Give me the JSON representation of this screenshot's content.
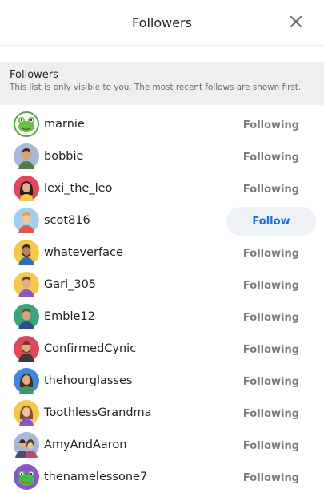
{
  "header": {
    "title": "Followers",
    "close_icon": "close-icon"
  },
  "notice": {
    "title": "Followers",
    "description": "This list is only visible to you. The most recent follows are shown first."
  },
  "colors": {
    "follow_accent": "#1a6fd1",
    "following_text": "#7a7a7a",
    "notice_bg": "#efefef"
  },
  "followers": [
    {
      "username": "marnie",
      "button": "Following",
      "avatar": "frog-avatar-icon"
    },
    {
      "username": "bobbie",
      "button": "Following",
      "avatar": "man-avatar-icon"
    },
    {
      "username": "lexi_the_leo",
      "button": "Following",
      "avatar": "woman-avatar-icon"
    },
    {
      "username": "scot816",
      "button": "Follow",
      "avatar": "man-avatar-icon"
    },
    {
      "username": "whateverface",
      "button": "Following",
      "avatar": "bearded-man-avatar-icon"
    },
    {
      "username": "Gari_305",
      "button": "Following",
      "avatar": "man-avatar-icon"
    },
    {
      "username": "Emble12",
      "button": "Following",
      "avatar": "man-avatar-icon"
    },
    {
      "username": "ConfirmedCynic",
      "button": "Following",
      "avatar": "bearded-man-avatar-icon"
    },
    {
      "username": "thehourglasses",
      "button": "Following",
      "avatar": "woman-avatar-icon"
    },
    {
      "username": "ToothlessGrandma",
      "button": "Following",
      "avatar": "woman-avatar-icon"
    },
    {
      "username": "AmyAndAaron",
      "button": "Following",
      "avatar": "couple-avatar-icon"
    },
    {
      "username": "thenamelessone7",
      "button": "Following",
      "avatar": "frog-avatar-icon"
    }
  ]
}
